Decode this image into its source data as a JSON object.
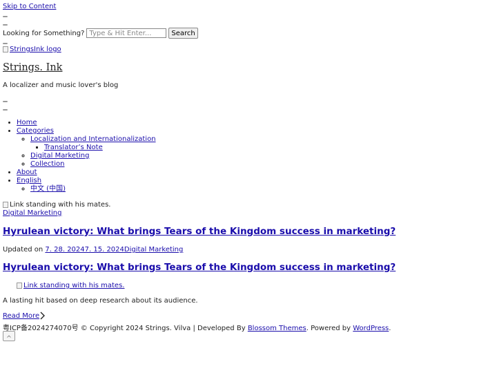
{
  "skip_link": "Skip to Content",
  "search": {
    "label": "Looking for Something?",
    "placeholder": "Type & Hit Enter...",
    "button": "Search"
  },
  "logo_alt": "StringsInk logo",
  "site": {
    "title": "Strings. Ink",
    "tagline": "A localizer and music lover's blog"
  },
  "nav": {
    "home": "Home",
    "categories": "Categories",
    "localization": "Localization and Internationalization",
    "translators_note": "Translator’s Note",
    "digital_marketing": "Digital Marketing",
    "collection": "Collection",
    "about": "About",
    "english": "English",
    "chinese": "中文 (中国)"
  },
  "post": {
    "image_alt": "Link standing with his mates.",
    "category": "Digital Marketing",
    "title": "Hyrulean victory: What brings Tears of the Kingdom success in marketing?",
    "updated_label": "Updated on",
    "dates": "7. 28. 20247. 15. 2024",
    "meta_category": "Digital Marketing",
    "title_repeat": "Hyrulean victory: What brings Tears of the Kingdom success in marketing?",
    "image_link_alt": "Link standing with his mates.",
    "excerpt": "A lasting hit based on deep research about its audience.",
    "read_more": "Read More"
  },
  "footer": {
    "icp": "粤ICP备2024274070号",
    "copyright": "© Copyright 2024 Strings. Vilva | Developed By",
    "blossom": "Blossom Themes",
    "powered": ". Powered by",
    "wordpress": "WordPress",
    "end": "."
  },
  "icons": {
    "read_more_arrow": "chevron-right-icon",
    "back_to_top": "chevron-up-icon"
  },
  "colors": {
    "link": "#1a0dab",
    "text": "#222222"
  }
}
